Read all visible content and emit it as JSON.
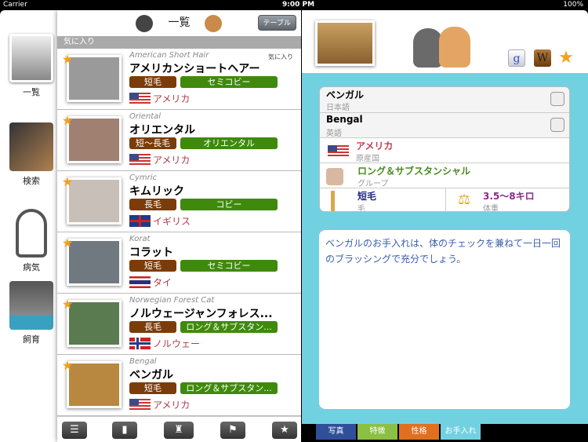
{
  "status": {
    "carrier": "Carrier",
    "time": "9:00 PM",
    "battery": "100%"
  },
  "sidebar": {
    "items": [
      {
        "label": "一覧",
        "icon": "photo-stack-icon"
      },
      {
        "label": "検索",
        "icon": "search-icon"
      },
      {
        "label": "病気",
        "icon": "stethoscope-icon"
      },
      {
        "label": "飼育",
        "icon": "cat-food-icon"
      }
    ]
  },
  "list": {
    "title": "一覧",
    "table_button": "テーブル",
    "section": "気に入り",
    "fav_label": "気に入り",
    "rows": [
      {
        "en": "American Short Hair",
        "jp": "アメリカンショートヘアー",
        "coat": "短毛",
        "group": "セミコビー",
        "country": "アメリカ",
        "flag": "us",
        "favorite": true
      },
      {
        "en": "Oriental",
        "jp": "オリエンタル",
        "coat": "短〜長毛",
        "group": "オリエンタル",
        "country": "アメリカ",
        "flag": "us",
        "favorite": true
      },
      {
        "en": "Cymric",
        "jp": "キムリック",
        "coat": "長毛",
        "group": "コビー",
        "country": "イギリス",
        "flag": "uk",
        "favorite": true
      },
      {
        "en": "Korat",
        "jp": "コラット",
        "coat": "短毛",
        "group": "セミコビー",
        "country": "タイ",
        "flag": "th",
        "favorite": true
      },
      {
        "en": "Norwegian Forest Cat",
        "jp": "ノルウェージャンフォレス...",
        "coat": "長毛",
        "group": "ロング＆サブスタン...",
        "country": "ノルウェー",
        "flag": "no",
        "favorite": true
      },
      {
        "en": "Bengal",
        "jp": "ベンガル",
        "coat": "短毛",
        "group": "ロング＆サブスタン...",
        "country": "アメリカ",
        "flag": "us",
        "favorite": true
      }
    ],
    "toolbar": [
      "list-index-icon",
      "comb-icon",
      "cat-group-icon",
      "flag-icon",
      "star-icon"
    ]
  },
  "detail": {
    "name_jp": "ベンガル",
    "name_jp_label": "日本語",
    "name_en": "Bengal",
    "name_en_label": "英語",
    "origin": "アメリカ",
    "origin_label": "原産国",
    "group": "ロング＆サブスタンシャル",
    "group_label": "グループ",
    "coat": "短毛",
    "coat_label": "毛",
    "weight": "3.5〜8キロ",
    "weight_label": "体重",
    "note": "ベンガルのお手入れは、体のチェックを兼ねて一日一回のブラッシングで充分でしょう。",
    "tabs": [
      {
        "label": "写真",
        "color": "#2f4f9a"
      },
      {
        "label": "特徴",
        "color": "#8ac043"
      },
      {
        "label": "性格",
        "color": "#e07020"
      },
      {
        "label": "お手入れ",
        "color": "#72d1e1"
      }
    ]
  }
}
